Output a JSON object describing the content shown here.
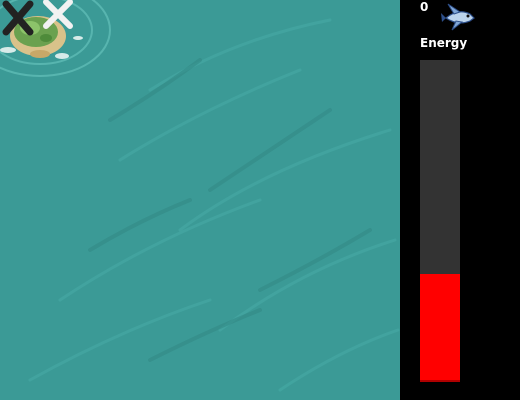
{
  "hud": {
    "score": "0",
    "energy_label": "Energy",
    "energy_level": 0.33,
    "fish_icon": "flying-fish-icon"
  },
  "scene": {
    "ocean_color": "#3b9a96",
    "island_icon": "island-icon",
    "crossed_planks_icon": "crossed-planks-icon"
  },
  "colors": {
    "energy_fill": "#ff0000",
    "energy_track": "#333333",
    "panel": "#000000"
  }
}
